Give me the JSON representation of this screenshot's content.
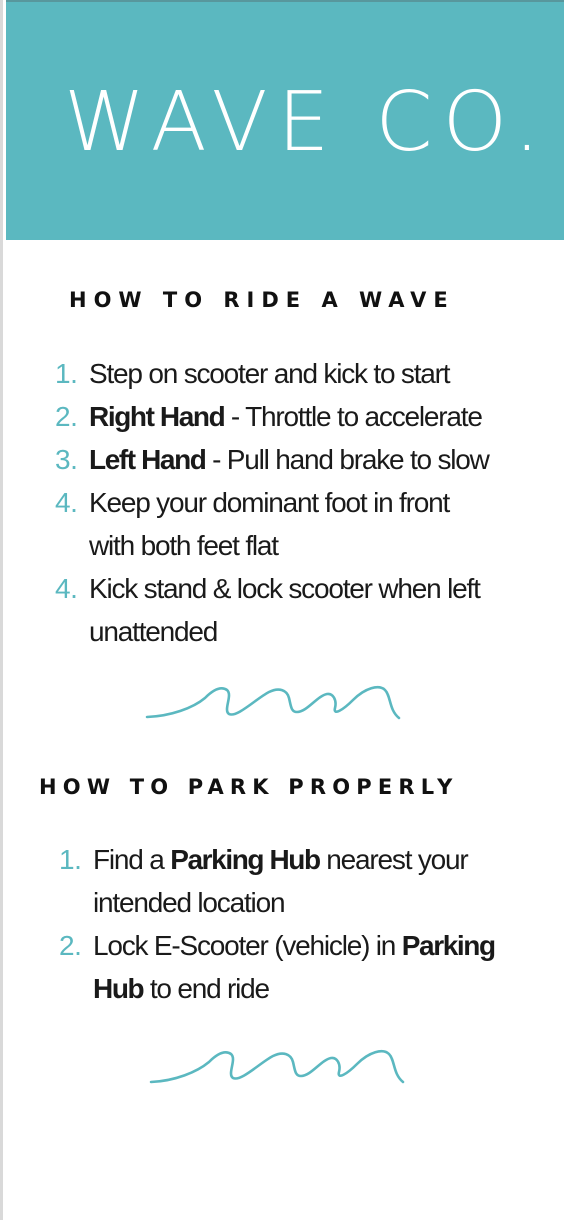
{
  "header": {
    "title": "WAVE CO."
  },
  "ride_section": {
    "heading": "HOW TO RIDE A WAVE",
    "steps": [
      {
        "num": "1.",
        "pre": "",
        "bold": "",
        "text": "Step on scooter and kick to start",
        "line2": ""
      },
      {
        "num": "2.",
        "pre": "",
        "bold": "Right Hand",
        "text": " - Throttle to accelerate",
        "line2": ""
      },
      {
        "num": "3.",
        "pre": "",
        "bold": "Left Hand",
        "text": " - Pull hand brake to slow",
        "line2": ""
      },
      {
        "num": "4.",
        "pre": "",
        "bold": "",
        "text": "Keep your dominant foot in front",
        "line2": "with both feet flat"
      },
      {
        "num": "4.",
        "pre": "",
        "bold": "",
        "text": "Kick stand & lock scooter when left",
        "line2": "unattended"
      }
    ]
  },
  "park_section": {
    "heading": "HOW TO PARK PROPERLY",
    "steps": [
      {
        "num": "1.",
        "pre": "Find a ",
        "bold": "Parking Hub",
        "text": " nearest your",
        "line2": "intended location"
      },
      {
        "num": "2.",
        "pre": "Lock E-Scooter (vehicle) in ",
        "bold": "Parking",
        "text": "",
        "line2_bold": "Hub",
        "line2": " to end ride"
      }
    ]
  },
  "decor": {
    "wave_icon_color": "#5bb8c0",
    "accent": "#5bb8c0"
  }
}
